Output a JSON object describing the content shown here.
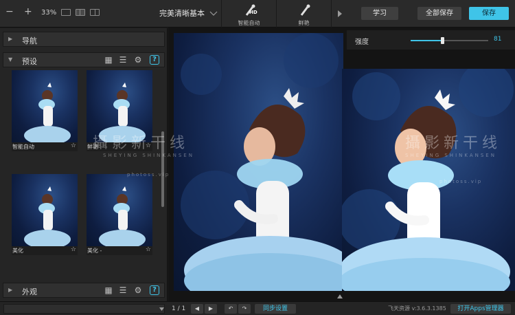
{
  "toolbar": {
    "zoom_out_icon": "minus-icon",
    "zoom_in_icon": "plus-icon",
    "zoom_level": "33%",
    "preset_name": "完美清晰基本",
    "modes": [
      {
        "label": "智能自动",
        "badge": "HD",
        "icon": "brush-hd-icon"
      },
      {
        "label": "鲜艳",
        "icon": "brush-icon"
      }
    ],
    "learn_label": "学习",
    "save_all_label": "全部保存",
    "save_label": "保存"
  },
  "adjust": {
    "strength_label": "强度",
    "strength_value": "81",
    "strength_level": 81,
    "strength_max": 100
  },
  "left_panel": {
    "nav_title": "导航",
    "presets_title": "预设",
    "look_title": "外观",
    "presets": [
      {
        "label": "智能自动"
      },
      {
        "label": "鲜艳"
      },
      {
        "label": "美化"
      },
      {
        "label": "美化 -"
      }
    ],
    "star_icon": "star-icon"
  },
  "watermark": {
    "text": "攝影新干线",
    "sub": "SHEYING SHINKANSEN",
    "url": "photoss.vip"
  },
  "bottom": {
    "page_counter": "1 / 1",
    "sync_label": "同步设置",
    "version": "飞天资源 v:3.6.3.1385",
    "apps_label": "打开Apps管理器"
  },
  "colors": {
    "accent": "#3fc4e8",
    "background": "#1b1b1b",
    "panel": "#252525"
  }
}
